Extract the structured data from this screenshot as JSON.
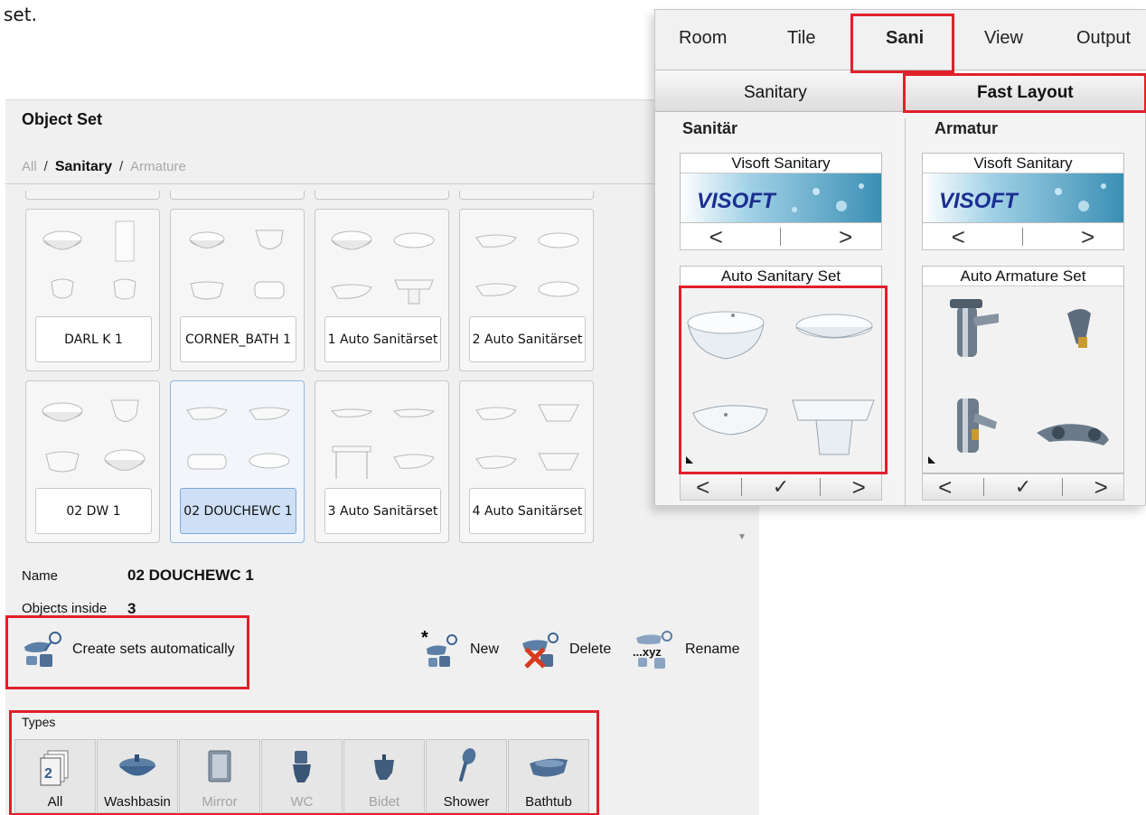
{
  "doc": {
    "text": "set."
  },
  "object_set": {
    "title": "Object Set",
    "breadcrumb": [
      "All",
      "Sanitary",
      "Armature"
    ],
    "cards": [
      {
        "label": "DARL K 1",
        "selected": false
      },
      {
        "label": "CORNER_BATH 1",
        "selected": false
      },
      {
        "label": "1 Auto Sanitärset",
        "selected": false
      },
      {
        "label": "2 Auto Sanitärset",
        "selected": false
      },
      {
        "label": "02 DW 1",
        "selected": false
      },
      {
        "label": "02 DOUCHEWC 1",
        "selected": true
      },
      {
        "label": "3 Auto Sanitärset",
        "selected": false
      },
      {
        "label": "4 Auto Sanitärset",
        "selected": false
      }
    ],
    "name_label": "Name",
    "name_value": "02 DOUCHEWC 1",
    "objects_label": "Objects inside",
    "objects_value": "3",
    "actions": {
      "create": "Create sets automatically",
      "new": "New",
      "delete": "Delete",
      "rename": "Rename",
      "rename_icon_text": "...xyz"
    },
    "types_label": "Types",
    "types": [
      {
        "label": "All",
        "enabled": true,
        "icon": "all-icon"
      },
      {
        "label": "Washbasin",
        "enabled": true,
        "icon": "washbasin-icon"
      },
      {
        "label": "Mirror",
        "enabled": false,
        "icon": "mirror-icon"
      },
      {
        "label": "WC",
        "enabled": false,
        "icon": "wc-icon"
      },
      {
        "label": "Bidet",
        "enabled": false,
        "icon": "bidet-icon"
      },
      {
        "label": "Shower",
        "enabled": true,
        "icon": "shower-icon"
      },
      {
        "label": "Bathtub",
        "enabled": true,
        "icon": "bathtub-icon"
      }
    ]
  },
  "ribbon": {
    "tabs": [
      "Room",
      "Tile",
      "Sani",
      "View",
      "Output"
    ],
    "active_tab": "Sani",
    "subtabs": [
      "Sanitary",
      "Fast Layout"
    ],
    "active_subtab": "Fast Layout",
    "sections": {
      "sanitar": {
        "title": "Sanitär",
        "catalog_title": "Visoft Sanitary",
        "logo_text": "VISOFT",
        "set_title": "Auto Sanitary Set"
      },
      "armatur": {
        "title": "Armatur",
        "catalog_title": "Visoft Sanitary",
        "logo_text": "VISOFT",
        "set_title": "Auto Armature Set"
      }
    },
    "nav": {
      "prev": "<",
      "next": ">",
      "apply": "✓"
    }
  },
  "colors": {
    "highlight_red": "#e0202a",
    "selected_blue": "#cfe0f6"
  }
}
